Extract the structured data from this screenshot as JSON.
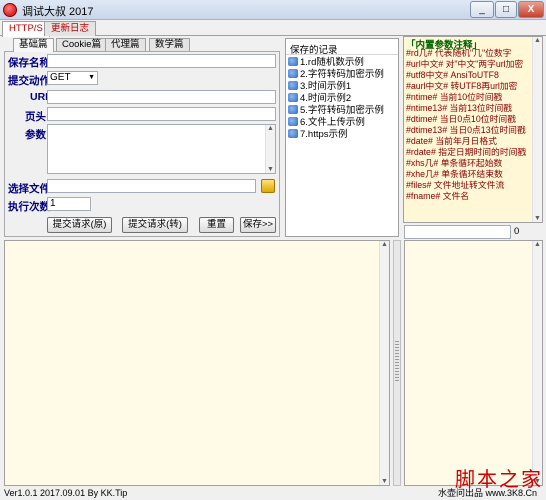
{
  "window": {
    "title": "调试大叔 2017",
    "minimize": "_",
    "maximize": "□",
    "close": "X"
  },
  "main_tabs": [
    {
      "label": "HTTP/S"
    },
    {
      "label": "更新日志"
    }
  ],
  "sub_tabs": [
    {
      "label": "基础篇"
    },
    {
      "label": "Cookie篇"
    },
    {
      "label": "代理篇"
    },
    {
      "label": "数学篇"
    }
  ],
  "form": {
    "save_name_label": "保存名称",
    "action_label": "提交动作",
    "action_value": "GET",
    "url_label": "URL",
    "page_label": "页头",
    "params_label": "参数",
    "file_label": "选择文件",
    "exec_count_label": "执行次数",
    "exec_count_value": "1",
    "submit_raw_label": "提交请求(原)",
    "submit_convert_label": "提交请求(转)",
    "reset_label": "重置",
    "save_label": "保存>>"
  },
  "history": {
    "title": "保存的记录",
    "items": [
      "1.rd随机数示例",
      "2.字符转码加密示例",
      "3.时间示例1",
      "4.时间示例2",
      "5.字符转码加密示例",
      "6.文件上传示例",
      "7.https示例"
    ]
  },
  "vars": {
    "title": "「内置参数注释」",
    "lines": [
      "#rd几#  代表随机\"几\"位数字",
      "#url中文#  对\"中文\"两字url加密",
      "#utf8中文#  AnsiToUTF8",
      "#aurl中文#  转UTF8再url加密",
      "#ntime#  当前10位时间戳",
      "#ntime13#  当前13位时间戳",
      "#dtime#  当日0点10位时间戳",
      "#dtime13#  当日0点13位时间戳",
      "#date#  当前年月日格式",
      "#rdate#  指定日期时间的时间戳",
      "#xhs几#  单条循环起始数",
      "#xhe几#  单条循环结束数",
      "#files#  文件地址转文件流",
      "#fname#  文件名"
    ],
    "counter": "0"
  },
  "status": {
    "left": "Ver1.0.1 2017.09.01 By KK.Tip",
    "right": "水壶问出品  www.3K8.Cn"
  },
  "watermark": "脚本之家"
}
